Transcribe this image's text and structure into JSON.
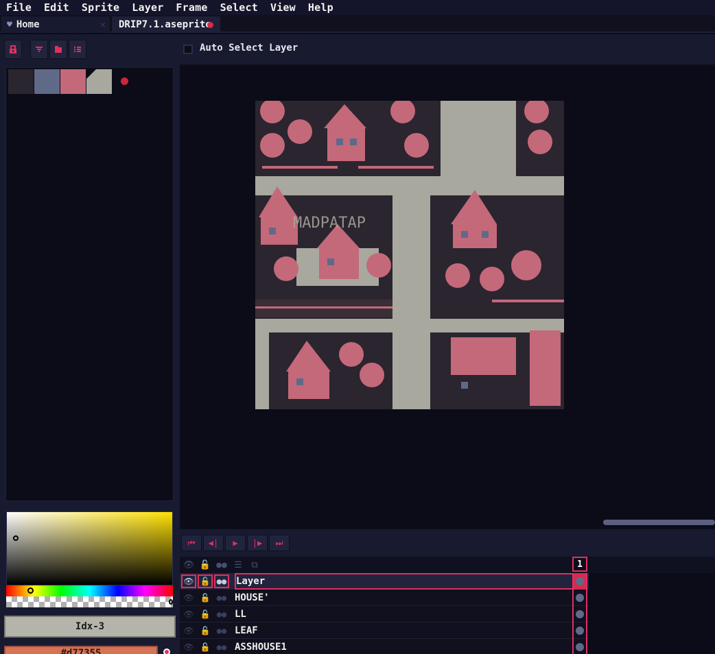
{
  "menu": [
    "File",
    "Edit",
    "Sprite",
    "Layer",
    "Frame",
    "Select",
    "View",
    "Help"
  ],
  "tabs": {
    "home": "Home",
    "file": "DRIP7.1.aseprite"
  },
  "toolbar": {
    "auto_select_label": "Auto Select Layer"
  },
  "palette": {
    "colors": [
      "#2b2530",
      "#5f6a88",
      "#c4697a",
      "#a8a89e"
    ]
  },
  "color": {
    "index_label": "Idx-3",
    "hex_label": "#d77355"
  },
  "canvas": {
    "watermark": "MADPATAP",
    "colors": {
      "dark": "#2b2530",
      "pink": "#c4697a",
      "gray": "#a8a89e",
      "blue": "#5f6a88"
    }
  },
  "timeline": {
    "frame_number": "1"
  },
  "layers": [
    {
      "name": "Layer",
      "active": true
    },
    {
      "name": "HOUSE'",
      "active": false
    },
    {
      "name": "LL",
      "active": false
    },
    {
      "name": "LEAF",
      "active": false
    },
    {
      "name": "ASSHOUSE1",
      "active": false
    }
  ]
}
